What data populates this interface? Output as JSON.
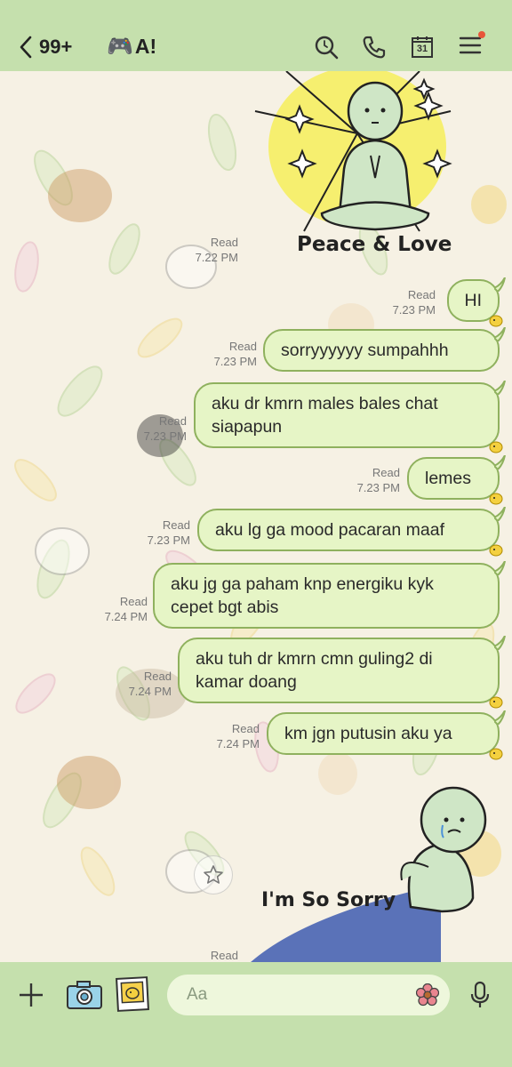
{
  "header": {
    "unread_count": "99+",
    "chat_name": "A!",
    "chat_emoji": "🎮",
    "colors": {
      "bar": "#c5e0ad",
      "notification_dot": "#e8553a"
    },
    "icons": [
      "back-arrow-icon",
      "search-icon",
      "phone-icon",
      "calendar-icon",
      "menu-icon"
    ],
    "calendar_day": "31"
  },
  "stickers": {
    "top": {
      "caption": "Peace & Love"
    },
    "bottom": {
      "caption": "I'm So Sorry"
    }
  },
  "messages": [
    {
      "status": "Read",
      "time": "7.22 PM",
      "type": "sticker"
    },
    {
      "status": "Read",
      "time": "7.23 PM",
      "lines": [
        "HI"
      ]
    },
    {
      "status": "Read",
      "time": "7.23 PM",
      "lines": [
        "sorryyyyyy sumpahhh"
      ]
    },
    {
      "status": "Read",
      "time": "7.23 PM",
      "lines": [
        "aku dr kmrn males bales chat",
        "siapapun"
      ]
    },
    {
      "status": "Read",
      "time": "7.23 PM",
      "lines": [
        "lemes"
      ]
    },
    {
      "status": "Read",
      "time": "7.23 PM",
      "lines": [
        "aku lg ga mood pacaran maaf"
      ]
    },
    {
      "status": "Read",
      "time": "7.24 PM",
      "lines": [
        "aku jg ga paham knp energiku kyk",
        "cepet bgt abis"
      ]
    },
    {
      "status": "Read",
      "time": "7.24 PM",
      "lines": [
        "aku tuh dr kmrn cmn guling2 di",
        "kamar doang"
      ]
    },
    {
      "status": "Read",
      "time": "7.24 PM",
      "lines": [
        "km jgn putusin aku ya"
      ]
    },
    {
      "status": "Read",
      "type": "sticker"
    }
  ],
  "bubble_colors": {
    "fill": "#e6f5c6",
    "border": "#8fb15e"
  },
  "input": {
    "placeholder": "Aa",
    "icons": [
      "plus-icon",
      "camera-icon",
      "photo-icon",
      "emoji-flower-icon",
      "microphone-icon"
    ]
  }
}
